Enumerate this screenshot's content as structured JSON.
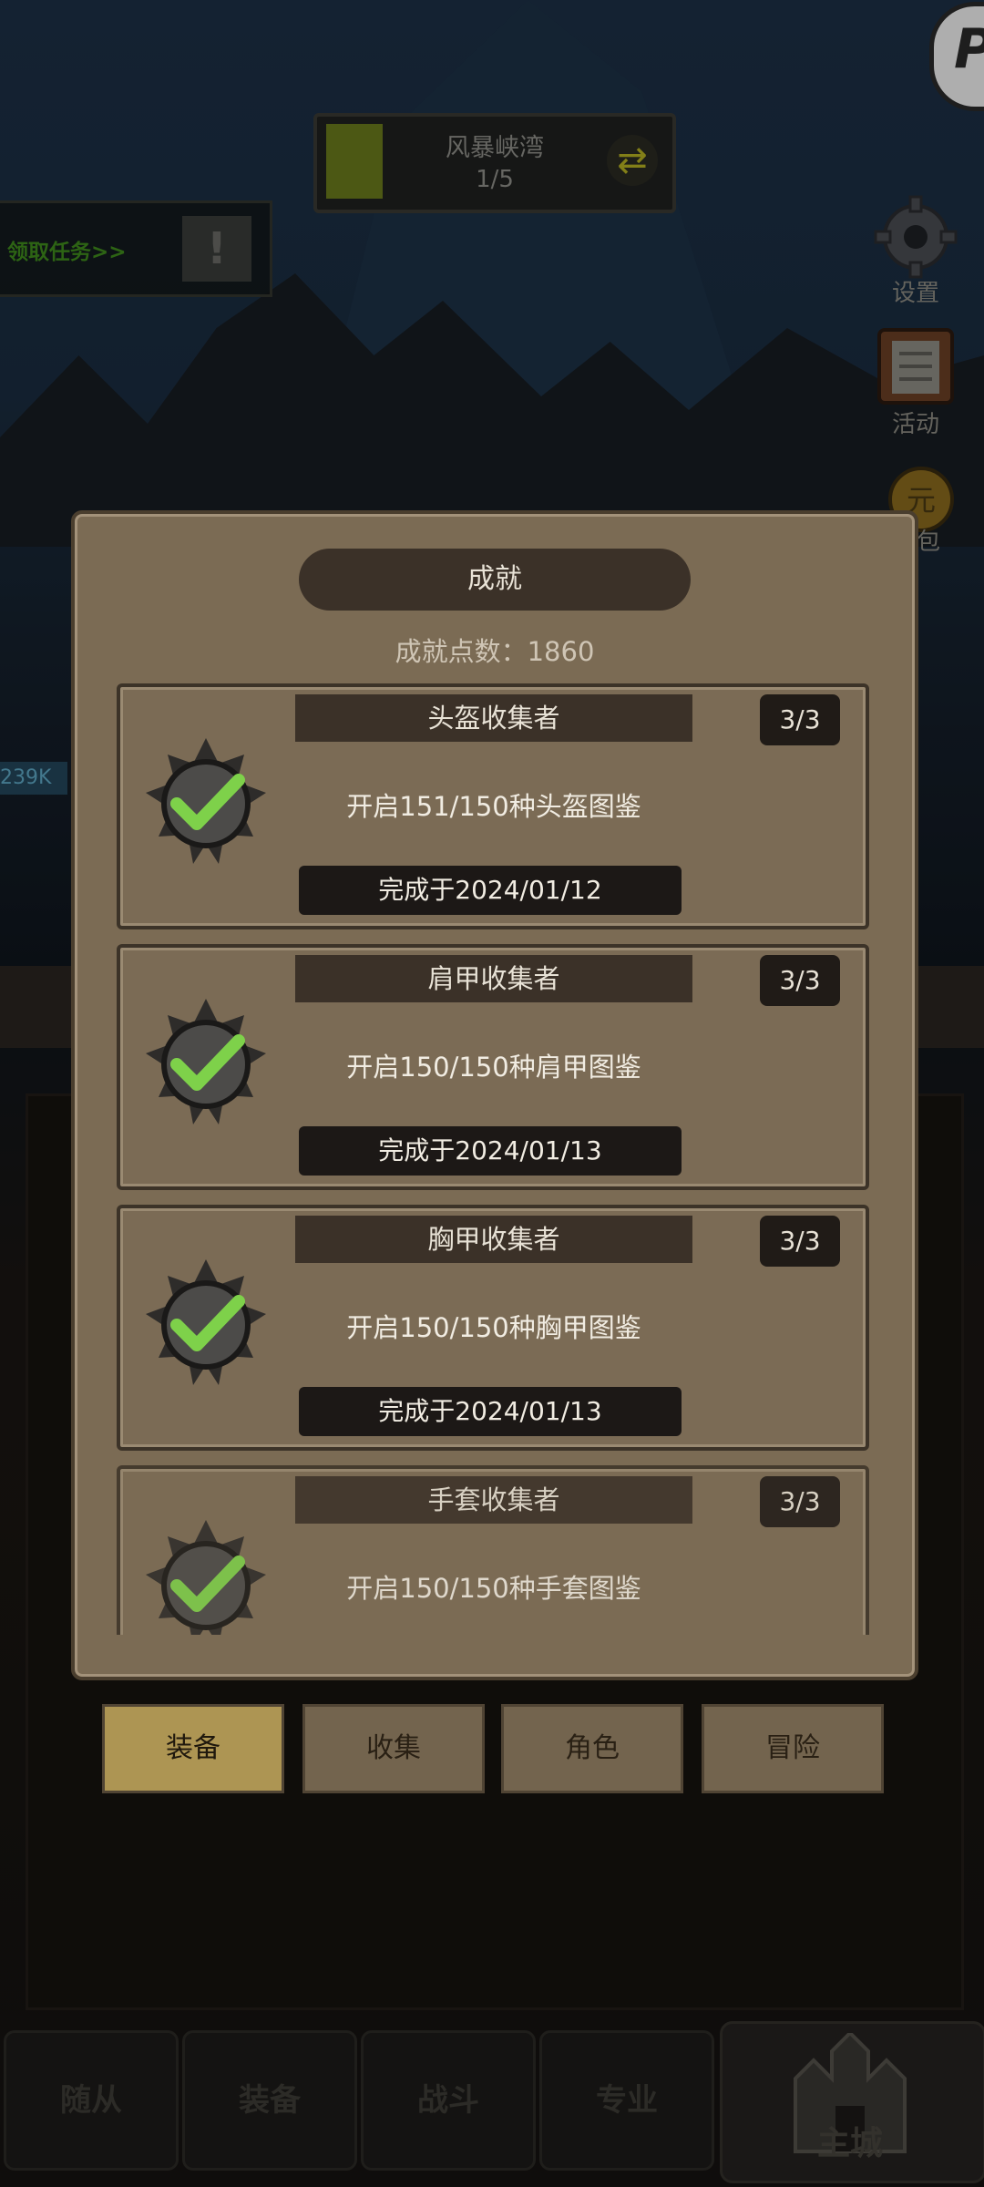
{
  "stage": {
    "name": "风暴峡湾",
    "progress": "1/5",
    "progress_fraction": 0.2
  },
  "quest": {
    "label": "领取任务>>",
    "alert": "!"
  },
  "side_menu": {
    "settings": "设置",
    "activity": "活动",
    "bag_partial": "包"
  },
  "modal": {
    "title": "成就",
    "points": "成就点数：1860",
    "items": [
      {
        "name": "头盔收集者",
        "progress": "3/3",
        "desc": "开启151/150种头盔图鉴",
        "date": "完成于2024/01/12"
      },
      {
        "name": "肩甲收集者",
        "progress": "3/3",
        "desc": "开启150/150种肩甲图鉴",
        "date": "完成于2024/01/13"
      },
      {
        "name": "胸甲收集者",
        "progress": "3/3",
        "desc": "开启150/150种胸甲图鉴",
        "date": "完成于2024/01/13"
      },
      {
        "name": "手套收集者",
        "progress": "3/3",
        "desc": "开启150/150种手套图鉴",
        "date": ""
      }
    ]
  },
  "category_tabs": [
    "装备",
    "收集",
    "角色",
    "冒险"
  ],
  "bottom_nav": [
    "随从",
    "装备",
    "战斗",
    "专业",
    "主城"
  ],
  "misc": {
    "left_badge": "239K"
  },
  "colors": {
    "active_tab": "#f0cf74",
    "check": "#7ed14a",
    "stage_fill": "#6a7a1c"
  }
}
